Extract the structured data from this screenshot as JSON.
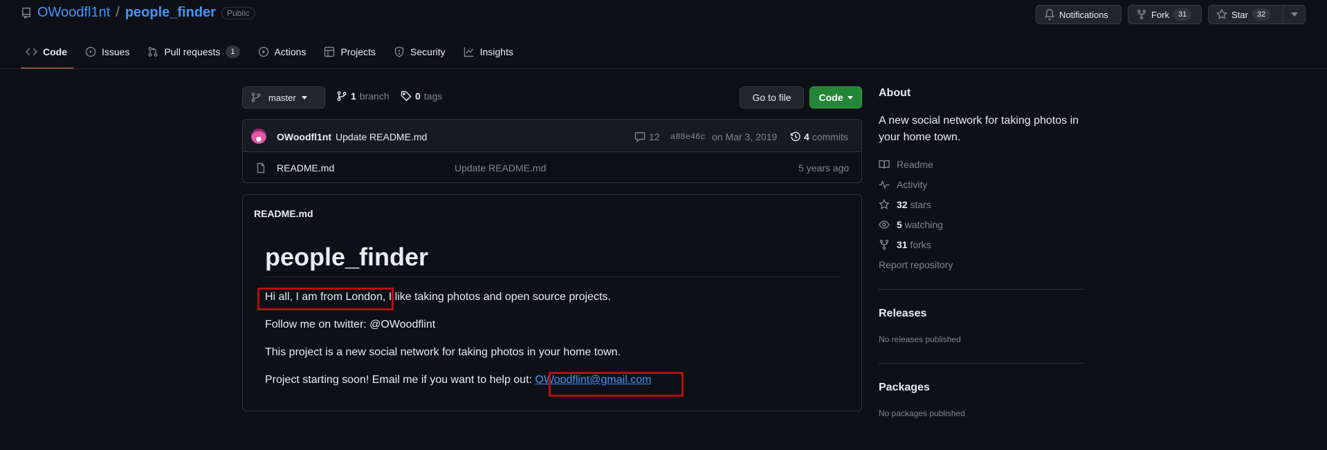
{
  "repo": {
    "owner": "OWoodfl1nt",
    "separator": "/",
    "name": "people_finder",
    "visibility": "Public"
  },
  "actions": {
    "notifications": "Notifications",
    "fork": "Fork",
    "fork_count": "31",
    "star": "Star",
    "star_count": "32"
  },
  "tabs": [
    {
      "label": "Code",
      "icon": "code-icon",
      "active": true
    },
    {
      "label": "Issues",
      "icon": "issue-icon"
    },
    {
      "label": "Pull requests",
      "icon": "pull-request-icon",
      "count": "1"
    },
    {
      "label": "Actions",
      "icon": "play-icon"
    },
    {
      "label": "Projects",
      "icon": "table-icon"
    },
    {
      "label": "Security",
      "icon": "shield-icon"
    },
    {
      "label": "Insights",
      "icon": "graph-icon"
    }
  ],
  "toolbar": {
    "branch_name": "master",
    "branch_count": "1",
    "branch_label": "branch",
    "tag_count": "0",
    "tag_label": "tags",
    "go_to_file": "Go to file",
    "code_button": "Code"
  },
  "commit": {
    "author": "OWoodfl1nt",
    "message": "Update README.md",
    "comment_count": "12",
    "sha": "a88e46c",
    "date": "on Mar 3, 2019",
    "commits_count": "4",
    "commits_label": "commits"
  },
  "files": [
    {
      "name": "README.md",
      "message": "Update README.md",
      "age": "5 years ago"
    }
  ],
  "readme": {
    "filename": "README.md",
    "heading": "people_finder",
    "p1": "Hi all, I am from London, I like taking photos and open source projects.",
    "p1_highlight": "Hi all, I am from London,",
    "p1_rest": " I like taking photos and open source projects.",
    "p2": "Follow me on twitter: @OWoodflint",
    "p3": "This project is a new social network for taking photos in your home town.",
    "p4_prefix": "Project starting soon! Email me if you want to help out: ",
    "p4_email": "OWoodflint@gmail.com"
  },
  "about": {
    "title": "About",
    "description": "A new social network for taking photos in your home town.",
    "readme": "Readme",
    "activity": "Activity",
    "stars_count": "32",
    "stars_label": "stars",
    "watching_count": "5",
    "watching_label": "watching",
    "forks_count": "31",
    "forks_label": "forks",
    "report": "Report repository"
  },
  "releases": {
    "title": "Releases",
    "empty": "No releases published"
  },
  "packages": {
    "title": "Packages",
    "empty": "No packages published"
  },
  "colors": {
    "background": "#0d1117",
    "accent": "#f78166",
    "link": "#4493f8",
    "code_button": "#238636",
    "highlight_box": "#b50f0f"
  }
}
